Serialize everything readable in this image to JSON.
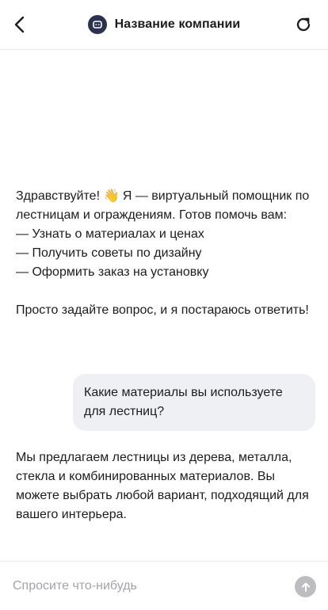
{
  "header": {
    "title": "Название компании",
    "back_icon": "chevron-left-icon",
    "refresh_icon": "refresh-icon",
    "avatar_icon": "bot-icon",
    "avatar_color": "#2b3250"
  },
  "messages": [
    {
      "role": "bot",
      "text": "Здравствуйте! 👋 Я — виртуальный помощник по лестницам и ограждениям. Готов помочь вам:\n— Узнать о материалах и ценах\n— Получить советы по дизайну\n— Оформить заказ на установку\n\nПросто задайте вопрос, и я постараюсь ответить!"
    },
    {
      "role": "user",
      "text": "Какие материалы вы используете для лестниц?"
    },
    {
      "role": "bot",
      "text": "Мы предлагаем лестницы из дерева, металла, стекла и комбинированных материалов. Вы можете выбрать любой вариант, подходящий для вашего интерьера."
    }
  ],
  "composer": {
    "placeholder": "Спросите что-нибудь",
    "value": "",
    "send_icon": "arrow-up-icon",
    "send_color": "#bdbdc1"
  }
}
